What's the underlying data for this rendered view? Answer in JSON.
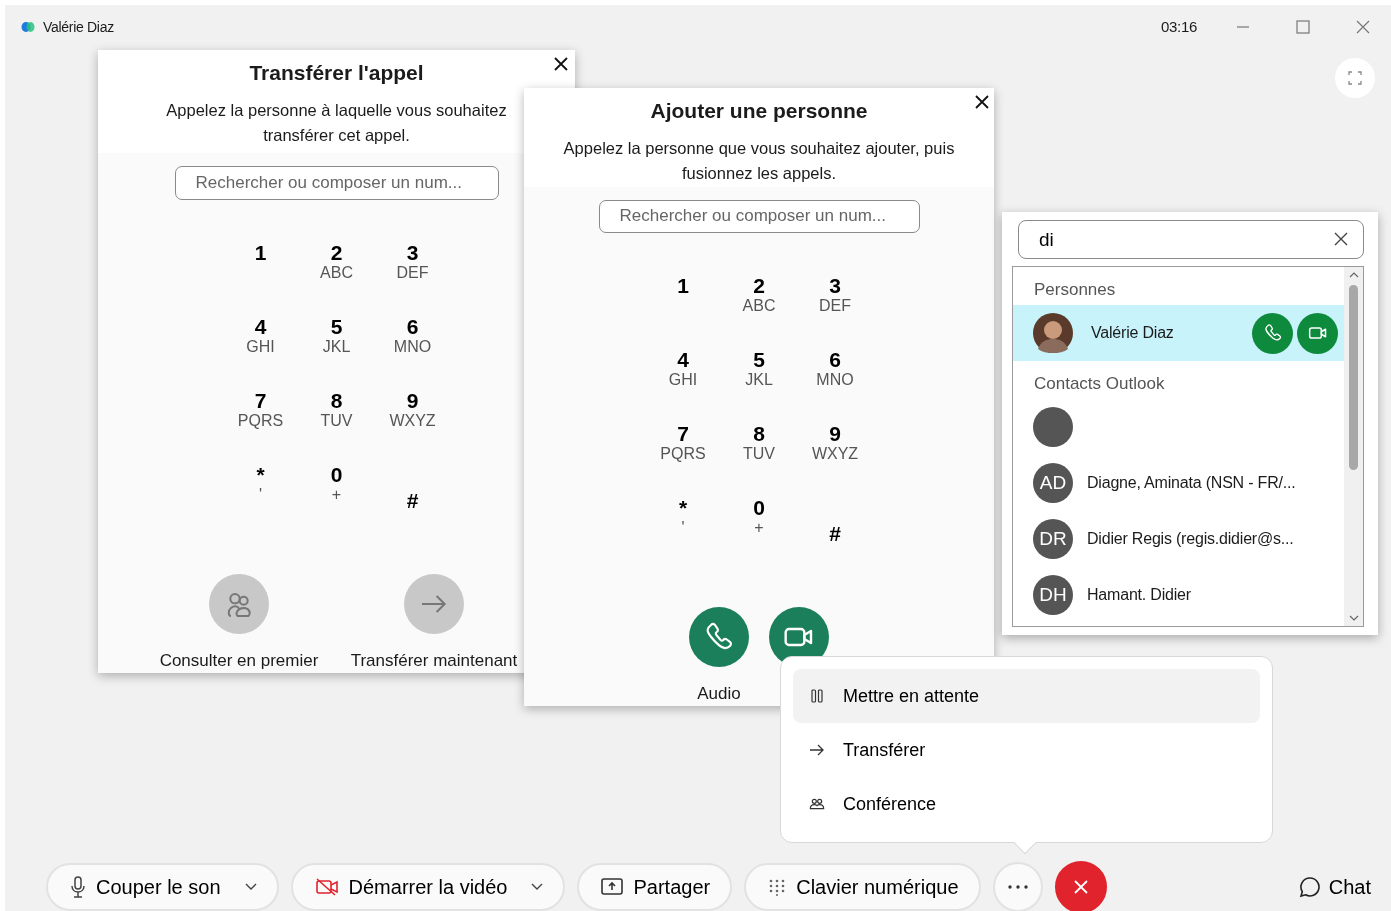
{
  "window": {
    "title": "Valérie Diaz",
    "call_time": "03:16"
  },
  "transfer_dialog": {
    "title": "Transférer l'appel",
    "description": "Appelez la personne à laquelle vous souhaitez transférer cet appel.",
    "search": {
      "placeholder": "Rechercher ou composer un num..."
    },
    "keypad": [
      {
        "digit": "1"
      },
      {
        "digit": "2",
        "letters": "ABC"
      },
      {
        "digit": "3",
        "letters": "DEF"
      },
      {
        "digit": "4",
        "letters": "GHI"
      },
      {
        "digit": "5",
        "letters": "JKL"
      },
      {
        "digit": "6",
        "letters": "MNO"
      },
      {
        "digit": "7",
        "letters": "PQRS"
      },
      {
        "digit": "8",
        "letters": "TUV"
      },
      {
        "digit": "9",
        "letters": "WXYZ"
      },
      {
        "digit": "*",
        "letters": "'"
      },
      {
        "digit": "0",
        "letters": "+"
      },
      {
        "digit": "#"
      }
    ],
    "actions": [
      {
        "label": "Consulter en premier",
        "kind": "consult"
      },
      {
        "label": "Transférer maintenant",
        "kind": "transfer"
      }
    ]
  },
  "add_dialog": {
    "title": "Ajouter une personne",
    "description": "Appelez la personne que vous souhaitez ajouter, puis fusionnez les appels.",
    "search": {
      "placeholder": "Rechercher ou composer un num..."
    },
    "keypad": [
      {
        "digit": "1"
      },
      {
        "digit": "2",
        "letters": "ABC"
      },
      {
        "digit": "3",
        "letters": "DEF"
      },
      {
        "digit": "4",
        "letters": "GHI"
      },
      {
        "digit": "5",
        "letters": "JKL"
      },
      {
        "digit": "6",
        "letters": "MNO"
      },
      {
        "digit": "7",
        "letters": "PQRS"
      },
      {
        "digit": "8",
        "letters": "TUV"
      },
      {
        "digit": "9",
        "letters": "WXYZ"
      },
      {
        "digit": "*",
        "letters": "'"
      },
      {
        "digit": "0",
        "letters": "+"
      },
      {
        "digit": "#"
      }
    ],
    "actions": [
      {
        "label": "Audio",
        "kind": "audio"
      },
      {
        "kind": "video"
      }
    ]
  },
  "contact_search": {
    "value": "di",
    "sections": [
      {
        "title": "Personnes",
        "contacts": [
          {
            "name": "Valérie Diaz",
            "kind": "photo",
            "selected": true,
            "call_actions": true
          }
        ]
      },
      {
        "title": "Contacts Outlook",
        "contacts": [
          {
            "kind": "blank",
            "selected": false,
            "call_actions": false
          },
          {
            "initials": "AD",
            "name": "Diagne, Aminata (NSN - FR/...",
            "kind": "initials",
            "selected": false,
            "call_actions": false
          },
          {
            "initials": "DR",
            "name": "Didier Regis (regis.didier@s...",
            "kind": "initials",
            "selected": false,
            "call_actions": false
          },
          {
            "initials": "DH",
            "name": "Hamant. Didier",
            "kind": "initials",
            "selected": false,
            "call_actions": false
          }
        ]
      }
    ]
  },
  "more_menu": {
    "items": [
      {
        "label": "Mettre en attente",
        "kind": "hold",
        "selected": true
      },
      {
        "label": "Transférer",
        "kind": "transfer",
        "selected": false
      },
      {
        "label": "Conférence",
        "kind": "conference",
        "selected": false
      }
    ]
  },
  "toolbar": {
    "buttons": [
      {
        "label": "Couper le son",
        "kind": "mic",
        "dropdown": true
      },
      {
        "label": "Démarrer la vidéo",
        "kind": "video-off",
        "dropdown": true
      },
      {
        "label": "Partager",
        "kind": "share",
        "dropdown": false
      },
      {
        "label": "Clavier numérique",
        "kind": "keypad",
        "dropdown": false
      },
      {
        "kind": "more"
      },
      {
        "kind": "end"
      }
    ],
    "chat": {
      "label": "Chat"
    }
  }
}
